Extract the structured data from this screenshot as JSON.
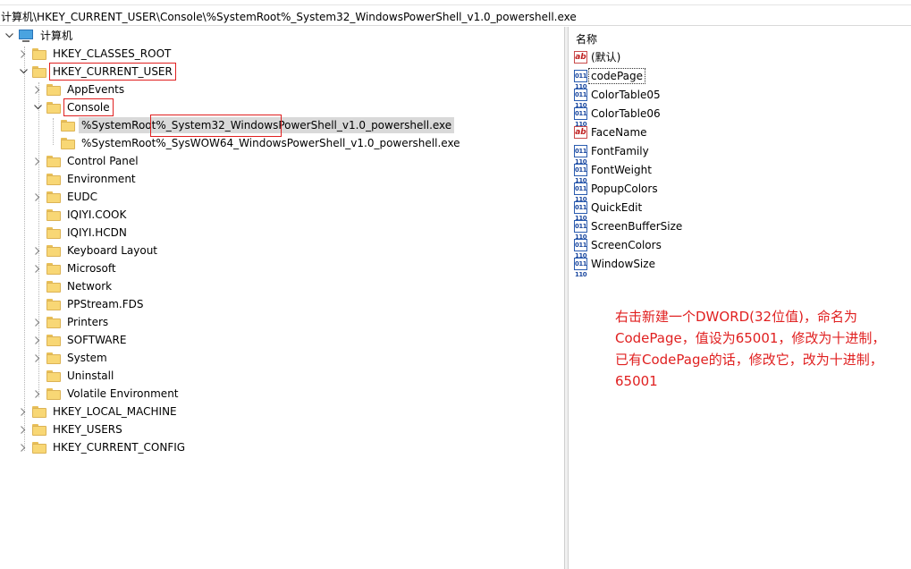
{
  "address": {
    "path": "计算机\\HKEY_CURRENT_USER\\Console\\%SystemRoot%_System32_WindowsPowerShell_v1.0_powershell.exe"
  },
  "tree": {
    "root_label": "计算机",
    "hkcr": "HKEY_CLASSES_ROOT",
    "hkcu": "HKEY_CURRENT_USER",
    "hkcu_children": [
      "AppEvents",
      "Console",
      "Control Panel",
      "Environment",
      "EUDC",
      "IQIYI.COOK",
      "IQIYI.HCDN",
      "Keyboard Layout",
      "Microsoft",
      "Network",
      "PPStream.FDS",
      "Printers",
      "SOFTWARE",
      "System",
      "Uninstall",
      "Volatile Environment"
    ],
    "console_children": [
      "%SystemRoot%_System32_WindowsPowerShell_v1.0_powershell.exe",
      "%SystemRoot%_SysWOW64_WindowsPowerShell_v1.0_powershell.exe"
    ],
    "hklm": "HKEY_LOCAL_MACHINE",
    "hku": "HKEY_USERS",
    "hkcc": "HKEY_CURRENT_CONFIG"
  },
  "values": {
    "column_name": "名称",
    "items": [
      {
        "name": "(默认)",
        "icon": "string-value-icon"
      },
      {
        "name": "codePage",
        "icon": "binary-value-icon"
      },
      {
        "name": "ColorTable05",
        "icon": "binary-value-icon"
      },
      {
        "name": "ColorTable06",
        "icon": "binary-value-icon"
      },
      {
        "name": "FaceName",
        "icon": "string-value-icon"
      },
      {
        "name": "FontFamily",
        "icon": "binary-value-icon"
      },
      {
        "name": "FontWeight",
        "icon": "binary-value-icon"
      },
      {
        "name": "PopupColors",
        "icon": "binary-value-icon"
      },
      {
        "name": "QuickEdit",
        "icon": "binary-value-icon"
      },
      {
        "name": "ScreenBufferSize",
        "icon": "binary-value-icon"
      },
      {
        "name": "ScreenColors",
        "icon": "binary-value-icon"
      },
      {
        "name": "WindowSize",
        "icon": "binary-value-icon"
      }
    ]
  },
  "annotation": {
    "line1": "右击新建一个DWORD(32位值)，命名为",
    "line2": "CodePage，值设为65001，修改为十进制，",
    "line3": "已有CodePage的话，修改它，改为十进制，",
    "line4": "65001"
  },
  "colors": {
    "annotation": "#e02020",
    "highlight_box": "#e02020",
    "selection": "#d9d9d9",
    "folder": "#f8d775"
  }
}
